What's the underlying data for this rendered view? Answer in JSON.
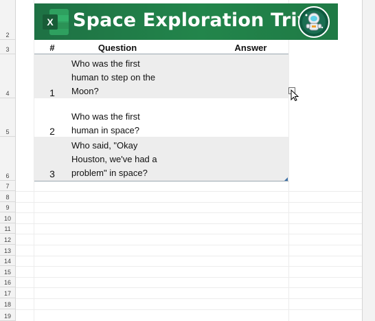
{
  "banner": {
    "title": "Space Exploration Trivia",
    "logo_letter": "X",
    "bg_color": "#1f7a45"
  },
  "row_numbers": [
    "2",
    "3",
    "4",
    "5",
    "6",
    "7",
    "8",
    "9",
    "10",
    "11",
    "12",
    "13",
    "14",
    "15",
    "16",
    "17",
    "18",
    "19"
  ],
  "table": {
    "headers": {
      "num": "#",
      "question": "Question",
      "answer": "Answer"
    },
    "rows": [
      {
        "num": "1",
        "question_lines": [
          "Who was the first",
          "human to step on the",
          "Moon?"
        ],
        "answer": ""
      },
      {
        "num": "2",
        "question_lines": [
          "Who was the first",
          "human in space?"
        ],
        "answer": ""
      },
      {
        "num": "3",
        "question_lines": [
          "Who said, \"Okay",
          "Houston, we've had a",
          "problem\" in space?"
        ],
        "answer": ""
      }
    ],
    "band_color": "#ededed"
  },
  "icons": {
    "logo": "excel-logo-icon",
    "mascot": "astronaut-icon",
    "pointer": "mouse-pointer-icon"
  }
}
